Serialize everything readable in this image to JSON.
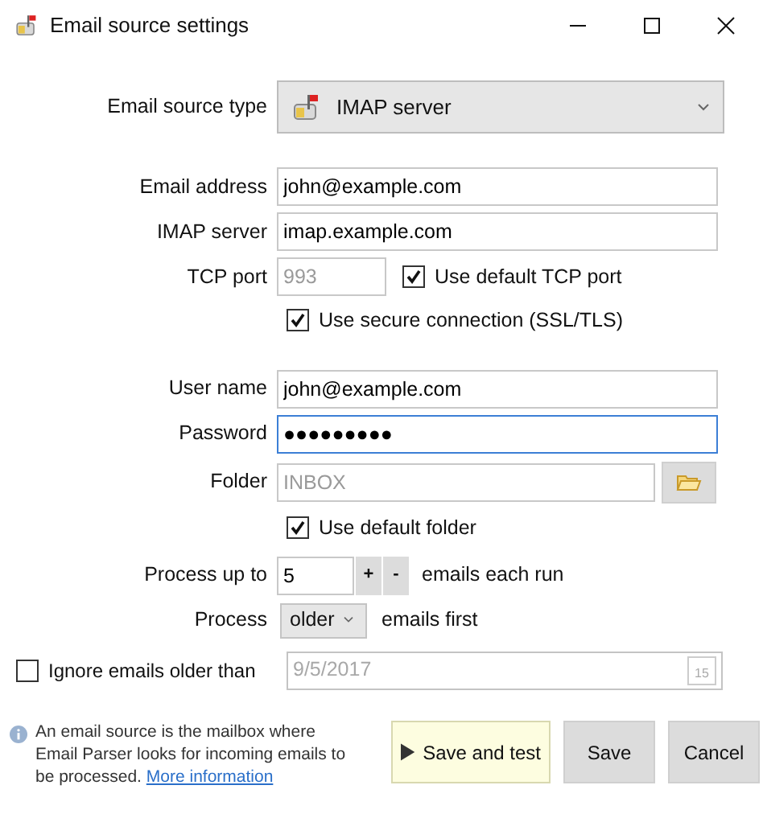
{
  "window": {
    "title": "Email source settings"
  },
  "source_type": {
    "label": "Email source type",
    "value": "IMAP server"
  },
  "email_address": {
    "label": "Email address",
    "value": "john@example.com"
  },
  "imap_server": {
    "label": "IMAP server",
    "value": "imap.example.com"
  },
  "tcp_port": {
    "label": "TCP port",
    "value": "993",
    "disabled": true
  },
  "use_default_port": {
    "label": "Use default TCP port",
    "checked": true
  },
  "use_secure": {
    "label": "Use secure connection (SSL/TLS)",
    "checked": true
  },
  "user_name": {
    "label": "User name",
    "value": "john@example.com",
    "focused": false
  },
  "password": {
    "label": "Password",
    "value": "●●●●●●●●●",
    "focused": true
  },
  "folder": {
    "label": "Folder",
    "value": "INBOX",
    "disabled": true
  },
  "use_default_folder": {
    "label": "Use default folder",
    "checked": true
  },
  "process_up_to": {
    "label": "Process up to",
    "value": "5",
    "plus": "+",
    "minus": "-",
    "suffix": "emails each run"
  },
  "process_order": {
    "label": "Process",
    "value": "older",
    "suffix": "emails first"
  },
  "ignore_older": {
    "label": "Ignore emails older than",
    "checked": false,
    "value": "9/5/2017",
    "disabled": true,
    "calendar_day": "15"
  },
  "info": {
    "text": "An email source is the mailbox where Email Parser looks for incoming emails to be processed.",
    "link": "More information"
  },
  "buttons": [
    {
      "label": "Save and test",
      "kind": "primary"
    },
    {
      "label": "Save",
      "kind": "normal"
    },
    {
      "label": "Cancel",
      "kind": "normal"
    }
  ]
}
